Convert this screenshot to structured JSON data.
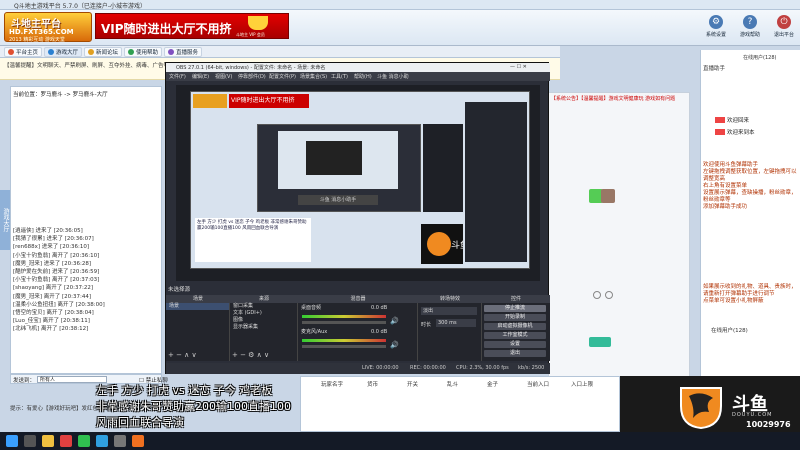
{
  "titlebar": {
    "text": "Q斗地主游戏平台 5.7.0（已连接户-小城市游戏）"
  },
  "logo": {
    "line1": "斗地主平台",
    "line2": "HD.FXT365.COM",
    "line3": "2013 精彩互动 游戏天堂"
  },
  "banner": {
    "text": "VIP随时进出大厅不用挤",
    "sub": "斗地主 VIP 会员"
  },
  "header_buttons": [
    {
      "label": "系统设置",
      "icon": "⚙"
    },
    {
      "label": "游戏帮助",
      "icon": "?"
    },
    {
      "label": "退出平台",
      "icon": "⏻"
    }
  ],
  "nav_tabs": [
    {
      "label": "平台主页",
      "color": "#e05030"
    },
    {
      "label": "游戏大厅",
      "color": "#2a80d0"
    },
    {
      "label": "新闻论坛",
      "color": "#e0a020"
    },
    {
      "label": "使用帮助",
      "color": "#30a050"
    },
    {
      "label": "直播服务",
      "color": "#8050c0"
    }
  ],
  "notice": {
    "text": "【温馨提醒】文明聊天、严禁刷屏、刷屏、互夺外挂、病毒、广告等违规行为。",
    "right": "【系统公告】【温馨提醒】游戏文明健康玩 游戏如有问题"
  },
  "left_panel": {
    "room_line": "当前位置：罗马鹿斗 -> 罗马鹿斗-大厅",
    "side_tab": "游戏大厅",
    "chat": [
      "[逍遥侠] 进来了 [20:36:05]",
      "[我猜了很累] 进来了 [20:36:07]",
      "[ren688x] 进来了 [20:36:10]",
      "[小宝十钓鱼翁] 离开了 [20:36:10]",
      "[魔男_冠来] 进来了 [20:36:28]",
      "[酷炉爱在失前] 进来了 [20:36:59]",
      "[小宝十钓鱼翁] 离开了 [20:37:03]",
      "[shaoyang] 离开了 [20:37:22]",
      "[魔男_冠来] 离开了 [20:37:44]",
      "[温柔小公鱼扭扭] 离开了 [20:38:00]",
      "[悟空的宝贝] 离开了 [20:38:04]",
      "[Luo_佳宝] 离开了 [20:38:11]",
      "[北纬飞机] 离开了 [20:38:12]"
    ]
  },
  "send_row": {
    "label": "发送到：",
    "target": "所有人",
    "checkbox": "禁止私聊"
  },
  "tips": {
    "text": "提示：有爱心【游戏好玩吧】发红包活动啦！"
  },
  "obs": {
    "title": "OBS 27.0.1 (64-bit, windows) - 配置文件: 未命名 - 场景: 未命名",
    "menu": [
      "文件(F)",
      "编辑(E)",
      "视图(V)",
      "停靠部件(D)",
      "配置文件(P)",
      "场景集合(S)",
      "工具(T)",
      "帮助(H)",
      "斗鱼 消息小助"
    ],
    "scene_label": "未选择源",
    "docks": [
      "场景",
      "来源",
      "混音器",
      "转场特效",
      "控件"
    ],
    "scenes": [
      "场景"
    ],
    "sources": [
      "窗口采集",
      "文本 (GDI+)",
      "图像",
      "显示器采集"
    ],
    "mixer": [
      {
        "name": "桌面音频",
        "db": "0.0 dB"
      },
      {
        "name": "麦克风/Aux",
        "db": "0.0 dB"
      }
    ],
    "transition": {
      "type": "淡出",
      "duration_label": "时长",
      "duration": "300 ms"
    },
    "controls": [
      "停止推流",
      "开始录制",
      "启动虚拟摄像机",
      "工作室模式",
      "设置",
      "退出"
    ],
    "status": {
      "live": "LIVE: 00:00:00",
      "rec": "REC: 00:00:00",
      "cpu": "CPU: 2.3%, 30.00 fps",
      "kb": "kb/s: 2500"
    },
    "nested_text": "左手 方少 打虎 vs 迷恋 子今 鸡老板 非常感谢朱哥赞助赢200输100直播100 风雨回血联合导演",
    "nested_ad": "斗鱼 消息小助手"
  },
  "right_panel": {
    "title": "直播助手",
    "user_count": "在线用户(128)",
    "welcome1": "欢迎回来",
    "welcome2": "欢迎来到本",
    "messages": [
      "欢迎使用斗鱼弹幕助手",
      "左键拖拽调整获取位置，左键拖拽可以调整宽高",
      "右上角有设置菜单",
      "设置展示弹幕，查缺操播，粉丝勋章，粉丝勋章等",
      "添加弹幕助手成功"
    ],
    "messages2": [
      "如果展示收到的礼物、道具、贵族时，请重新打开弹幕助手进行调节",
      "点菜单可设置小礼物屏蔽"
    ],
    "online_label": "在线用户(128)"
  },
  "subtitles": [
    "左手 方少 打虎 vs 迷恋 子今 鸡老板",
    "非常感谢朱哥赞助赢200输100直播100",
    "风雨回血联合导演"
  ],
  "table": {
    "headers": [
      "玩家名字",
      "货币",
      "开关",
      "乱斗",
      "金子",
      "当前入口",
      "入口上限"
    ]
  },
  "douyu": {
    "brand": "斗鱼",
    "brand_en": "DOUYU.COM",
    "room": "10029976"
  },
  "taskbar": {
    "icons": [
      {
        "name": "windows-start-icon",
        "color": "#3aa0ff"
      },
      {
        "name": "search-icon",
        "color": "#555"
      },
      {
        "name": "file-explorer-icon",
        "color": "#f0c040"
      },
      {
        "name": "chrome-icon",
        "color": "#e04040"
      },
      {
        "name": "wechat-icon",
        "color": "#30c050"
      },
      {
        "name": "qq-icon",
        "color": "#30a0e0"
      },
      {
        "name": "obs-icon",
        "color": "#777"
      },
      {
        "name": "douyu-icon",
        "color": "#f07020"
      }
    ]
  }
}
